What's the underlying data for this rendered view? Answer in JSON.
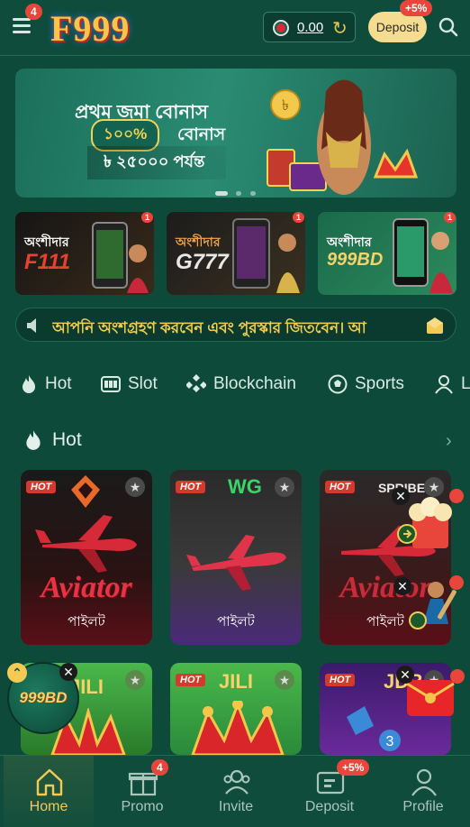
{
  "header": {
    "menu_badge": "4",
    "logo_text": "F999",
    "balance": "0.00",
    "deposit_label": "Deposit",
    "deposit_bonus": "+5%"
  },
  "banner": {
    "line1": "প্রথম জমা বোনাস",
    "pill": "১০০%",
    "line2": "বোনাস",
    "line3": "৳ ২৫০০০ পর্যন্ত",
    "slide_count": 3,
    "active_slide": 0
  },
  "brand_cards": [
    {
      "sub": "অংশীদার",
      "name": "F111"
    },
    {
      "sub": "অংশীদার",
      "name": "G777"
    },
    {
      "sub": "অংশীদার",
      "name": "999BD"
    }
  ],
  "marquee": {
    "text": "আপনি অংশগ্রহণ করবেন এবং পুরস্কার জিতবেন। আ"
  },
  "categories": [
    {
      "label": "Hot",
      "icon": "flame-icon"
    },
    {
      "label": "Slot",
      "icon": "slot-machine-icon"
    },
    {
      "label": "Blockchain",
      "icon": "blockchain-icon"
    },
    {
      "label": "Sports",
      "icon": "soccer-ball-icon"
    },
    {
      "label": "L",
      "icon": "live-dealer-icon"
    }
  ],
  "section": {
    "title": "Hot"
  },
  "games_row1": [
    {
      "hot": "HOT",
      "provider": "",
      "title": "Aviator",
      "label": "পাইলট"
    },
    {
      "hot": "HOT",
      "provider": "WG",
      "title": "",
      "label": "পাইলট"
    },
    {
      "hot": "HOT",
      "provider": "SPRIBE",
      "title": "Aviator",
      "label": "পাইলট"
    }
  ],
  "games_row2": [
    {
      "hot": "",
      "provider": "JILI"
    },
    {
      "hot": "HOT",
      "provider": "JILI"
    },
    {
      "hot": "HOT",
      "provider": "JDB"
    }
  ],
  "floater": {
    "text": "999BD"
  },
  "bottom_nav": [
    {
      "label": "Home",
      "icon": "home-icon",
      "badge": ""
    },
    {
      "label": "Promo",
      "icon": "gift-icon",
      "badge": "4"
    },
    {
      "label": "Invite",
      "icon": "users-icon",
      "badge": ""
    },
    {
      "label": "Deposit",
      "icon": "wallet-icon",
      "badge": "+5%"
    },
    {
      "label": "Profile",
      "icon": "user-icon",
      "badge": ""
    }
  ],
  "colors": {
    "background": "#0e4a3a",
    "accent_gold": "#f2ca54",
    "badge_red": "#e8463a"
  }
}
